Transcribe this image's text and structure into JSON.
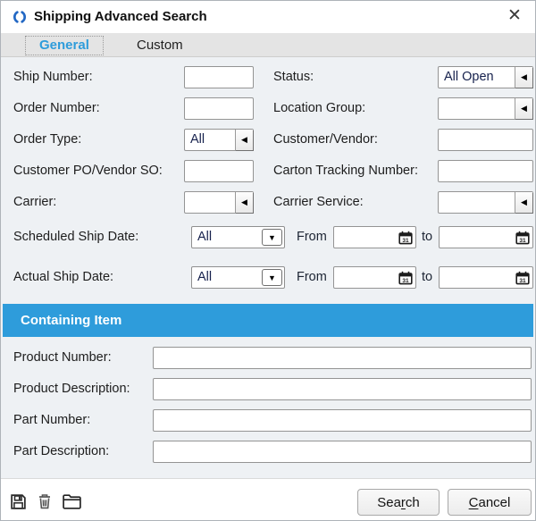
{
  "window": {
    "title": "Shipping Advanced Search"
  },
  "icons": {
    "app_logo": "fishbowl-logo",
    "close": "✕",
    "combo_arrow": "◀",
    "dropdown_arrow": "▼",
    "calendar": "calendar-31",
    "save": "floppy-disk",
    "delete": "trash-can",
    "open": "folder"
  },
  "colors": {
    "accent_blue": "#2E9CDB",
    "logo_blue": "#2368C4"
  },
  "tabs": {
    "general": "General",
    "custom": "Custom"
  },
  "fields": {
    "ship_number": {
      "label": "Ship Number:",
      "value": ""
    },
    "status": {
      "label": "Status:",
      "value": "All Open"
    },
    "order_number": {
      "label": "Order Number:",
      "value": ""
    },
    "location_group": {
      "label": "Location Group:",
      "value": ""
    },
    "order_type": {
      "label": "Order Type:",
      "value": "All"
    },
    "customer_vendor": {
      "label": "Customer/Vendor:",
      "value": ""
    },
    "customer_po_vendor_so": {
      "label": "Customer PO/Vendor SO:",
      "value": ""
    },
    "carton_tracking_number": {
      "label": "Carton Tracking Number:",
      "value": ""
    },
    "carrier": {
      "label": "Carrier:",
      "value": ""
    },
    "carrier_service": {
      "label": "Carrier Service:",
      "value": ""
    },
    "scheduled_ship_date": {
      "label": "Scheduled Ship Date:",
      "mode": "All",
      "from_label": "From",
      "to_label": "to",
      "from_value": "",
      "to_value": ""
    },
    "actual_ship_date": {
      "label": "Actual Ship Date:",
      "mode": "All",
      "from_label": "From",
      "to_label": "to",
      "from_value": "",
      "to_value": ""
    }
  },
  "containing_item": {
    "header": "Containing Item",
    "product_number": {
      "label": "Product Number:",
      "value": ""
    },
    "product_description": {
      "label": "Product Description:",
      "value": ""
    },
    "part_number": {
      "label": "Part Number:",
      "value": ""
    },
    "part_description": {
      "label": "Part Description:",
      "value": ""
    }
  },
  "footer": {
    "search": {
      "pre": "Sea",
      "mnemonic": "r",
      "post": "ch"
    },
    "cancel": {
      "pre": "",
      "mnemonic": "C",
      "post": "ancel"
    }
  }
}
